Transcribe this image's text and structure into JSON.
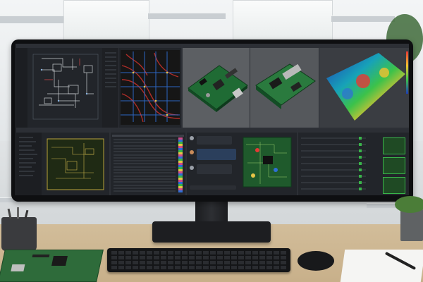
{
  "scene": {
    "colors": {
      "monitor_bezel": "#0e0f11",
      "screen_bg": "#1a1c20",
      "desk": "#c8b08a",
      "pcb_green": "#2e6b3a",
      "heatmap_hot": "#e53935",
      "heatmap_cool": "#1e3cb4",
      "status_green": "#39b54a"
    },
    "objects": {
      "monitor_icon": "ultrawide-monitor-icon",
      "keyboard_icon": "keyboard-icon",
      "mouse_icon": "mouse-icon",
      "pcb_icon": "circuit-board-icon",
      "cup_icon": "pen-holder-icon",
      "plant_icon": "potted-plant-icon",
      "paper_icon": "document-icon",
      "pen_icon": "pen-icon"
    }
  },
  "screen": {
    "panels_top": [
      "schematic-editor",
      "pcb-layout-editor",
      "3d-board-view-angled",
      "3d-board-view-iso",
      "thermal-analysis"
    ],
    "panels_bottom": [
      "layer-tree",
      "pcb-routing-view",
      "bom-table",
      "review-chat",
      "status-checklist"
    ]
  }
}
